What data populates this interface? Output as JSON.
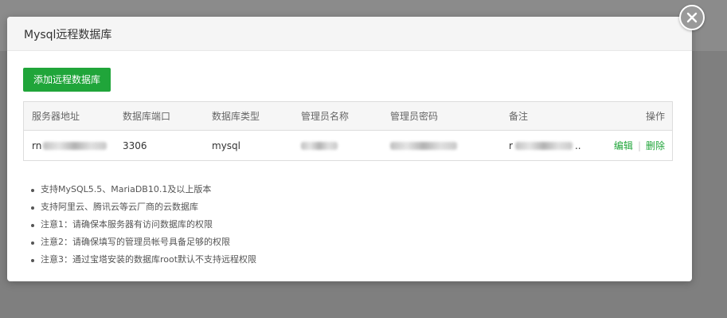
{
  "modal": {
    "title": "Mysql远程数据库",
    "add_button_label": "添加远程数据库"
  },
  "table": {
    "headers": [
      "服务器地址",
      "数据库端口",
      "数据库类型",
      "管理员名称",
      "管理员密码",
      "备注",
      "操作"
    ],
    "rows": [
      {
        "server_prefix": "rn",
        "port": "3306",
        "type": "mysql",
        "note_prefix": "r",
        "note_suffix": "..",
        "edit_label": "编辑",
        "separator": "|",
        "delete_label": "删除"
      }
    ]
  },
  "notes": [
    "支持MySQL5.5、MariaDB10.1及以上版本",
    "支持阿里云、腾讯云等云厂商的云数据库",
    "注意1：请确保本服务器有访问数据库的权限",
    "注意2：请确保填写的管理员帐号具备足够的权限",
    "注意3：通过宝塔安装的数据库root默认不支持远程权限"
  ],
  "colors": {
    "accent": "#20a53a",
    "overlay": "#7f7f7f"
  },
  "icons": {
    "close": "close-circle-icon"
  }
}
